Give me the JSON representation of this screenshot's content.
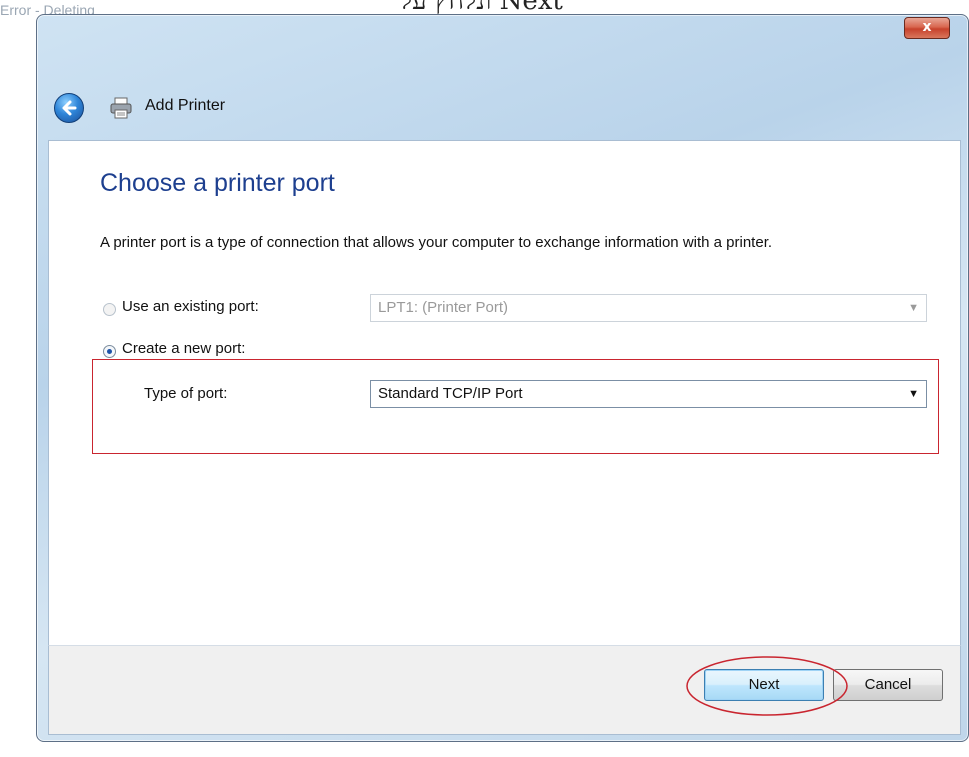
{
  "top_caption": "ונלחץ על Next",
  "background_window_title": "Error - Deleting",
  "window": {
    "title": "Add Printer",
    "close_label": "x"
  },
  "page": {
    "heading": "Choose a printer port",
    "description": "A printer port is a type of connection that allows your computer to exchange information with a printer."
  },
  "options": {
    "existing_port": {
      "label": "Use an existing port:",
      "selected": false,
      "value": "LPT1: (Printer Port)"
    },
    "new_port": {
      "label": "Create a new port:",
      "selected": true,
      "type_label": "Type of port:",
      "value": "Standard TCP/IP Port"
    }
  },
  "buttons": {
    "next": "Next",
    "cancel": "Cancel"
  },
  "colors": {
    "heading": "#1d3f8f",
    "highlight": "#c9252f"
  },
  "icons": [
    "back-arrow-icon",
    "printer-icon",
    "close-icon",
    "chevron-down-icon"
  ]
}
